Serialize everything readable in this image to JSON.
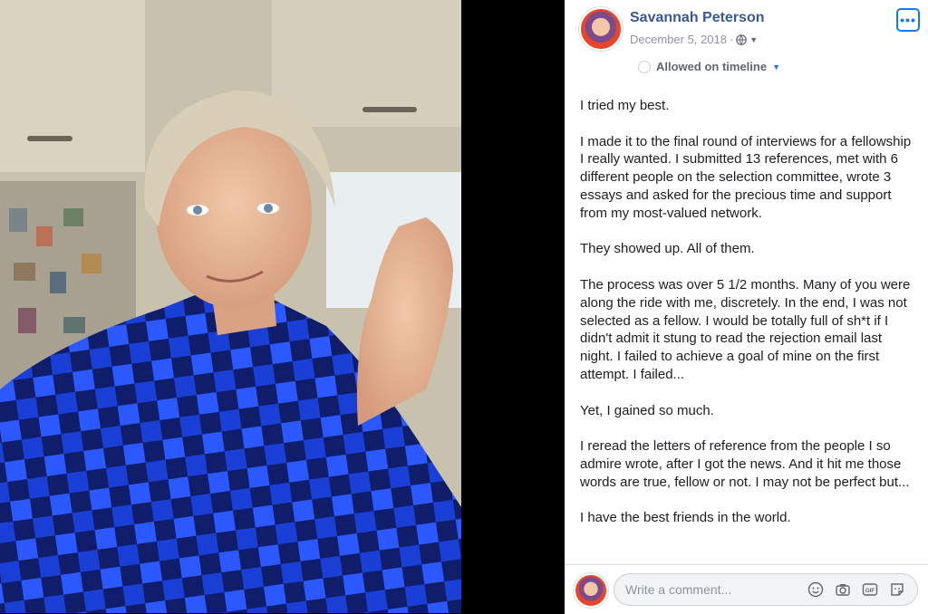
{
  "post": {
    "author": "Savannah Peterson",
    "date": "December 5, 2018",
    "date_separator": "·",
    "timeline_status": "Allowed on timeline",
    "paragraphs": [
      "I tried my best.",
      "I made it to the final round of interviews for a fellowship I really wanted. I submitted 13 references, met with 6 different people on the selection committee, wrote 3 essays and asked for the precious time and support from my most-valued network.",
      "They showed up. All of them.",
      "The process was over 5 1/2 months. Many of you were along the ride with me, discretely. In the end, I was not selected as a fellow. I would be totally full of sh*t if I didn't admit it stung to read the rejection email last night. I failed to achieve a goal of mine on the first attempt. I failed...",
      "Yet, I gained so much.",
      "I reread the letters of reference from the people I so admire wrote, after I got the news. And it hit me those words are true, fellow or not. I may not be perfect but...",
      "I have the best friends in the world."
    ]
  },
  "comment": {
    "placeholder": "Write a comment...",
    "icons": [
      "emoji-icon",
      "camera-icon",
      "gif-icon",
      "sticker-icon"
    ]
  },
  "colors": {
    "link": "#385898",
    "accent": "#1877f2",
    "shirt_blue": "#1a3fd6"
  }
}
